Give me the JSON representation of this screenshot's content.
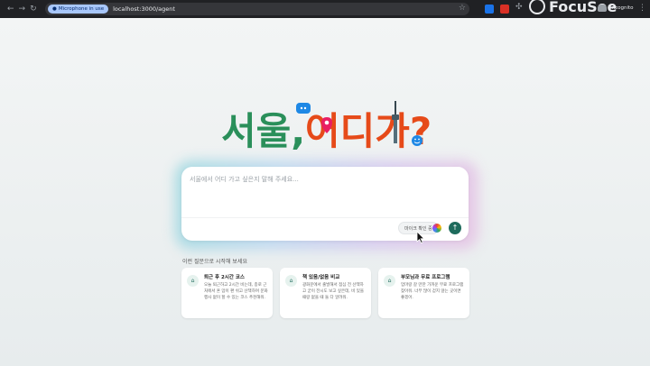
{
  "browser": {
    "mic_badge": "Microphone in use",
    "url": "localhost:3000/agent",
    "incognito_label": "Incognito",
    "recorder_brand": "FocuSee"
  },
  "hero": {
    "title_part1": "서울,",
    "title_part2": "어디가?"
  },
  "search": {
    "placeholder": "서울에서 어디 가고 싶은지 말해 주세요...",
    "mic_check_label": "마이크 확인 중"
  },
  "suggestions": {
    "title": "이런 질문으로 시작해 보세요",
    "cards": [
      {
        "title": "퇴근 후 2시간 코스",
        "desc": "오늘 퇴근하고 2시간 비는데, 종로 근처에서 혼 맘이 편 쉬고 산책하며 문화행사 없이 할 수 있는 코스 추천해줘.",
        "icon": "landmark-icon"
      },
      {
        "title": "책 있음/없음 비교",
        "desc": "광화문에서 출발해서 점심 전 산책하고 굳이 전시도 보고 싶은데, 비 있을 때랑 없을 때 둘 다 알려줘.",
        "icon": "landmark-icon"
      },
      {
        "title": "부모님과 무료 프로그램",
        "desc": "엄마랑 갈 만한 가까운 무료 프로그램 찾아줘. 너무 많이 걷지 않는 곳이면 좋겠어.",
        "icon": "landmark-icon"
      }
    ]
  }
}
